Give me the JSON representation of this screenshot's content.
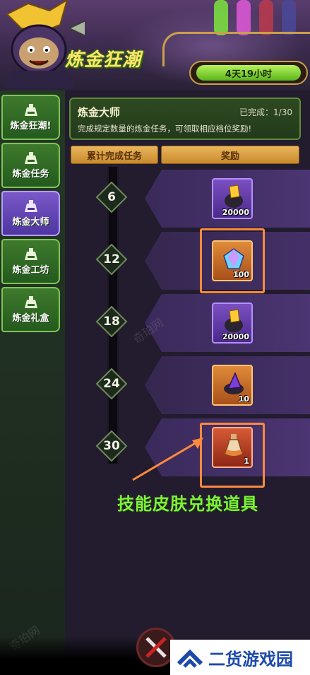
{
  "header": {
    "title": "炼金狂潮",
    "timer": "4天19小时"
  },
  "sidebar": {
    "items": [
      {
        "label": "炼金狂潮!",
        "active": false
      },
      {
        "label": "炼金任务",
        "active": false
      },
      {
        "label": "炼金大师",
        "active": true
      },
      {
        "label": "炼金工坊",
        "active": false
      },
      {
        "label": "炼金礼盒",
        "active": false
      }
    ]
  },
  "panel": {
    "title": "炼金大师",
    "progress": "已完成：1/30",
    "description": "完成规定数量的炼金任务，可领取相应档位奖励!",
    "col_tasks": "累计完成任务",
    "col_reward": "奖励"
  },
  "milestones": [
    {
      "level": "6",
      "reward": {
        "icon": "gold-ore-icon",
        "qty": "20000",
        "rarity": "purple"
      }
    },
    {
      "level": "12",
      "reward": {
        "icon": "rainbow-crystal-icon",
        "qty": "100",
        "rarity": "orange"
      }
    },
    {
      "level": "18",
      "reward": {
        "icon": "gold-ore-icon",
        "qty": "20000",
        "rarity": "purple"
      }
    },
    {
      "level": "24",
      "reward": {
        "icon": "purple-crystal-icon",
        "qty": "10",
        "rarity": "orange"
      }
    },
    {
      "level": "30",
      "reward": {
        "icon": "potion-bottle-icon",
        "qty": "1",
        "rarity": "red"
      }
    }
  ],
  "annotation": "技能皮肤兑换道具",
  "watermark": {
    "brand": "二货游戏园",
    "faint": "奇珀网"
  },
  "colors": {
    "accent_green": "#7ef03a",
    "highlight_orange": "#ff8a3d",
    "active_tab": "#6a4bbd",
    "tab_green": "#2f6b25"
  }
}
